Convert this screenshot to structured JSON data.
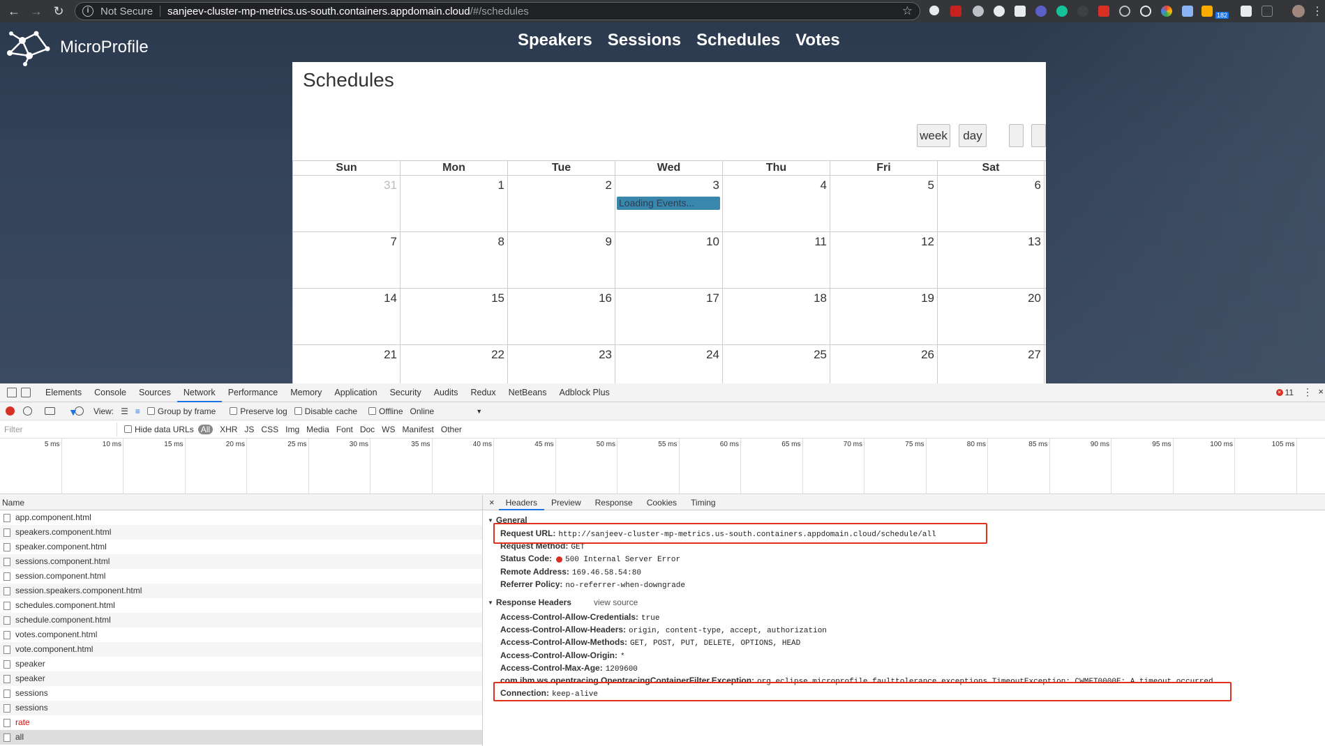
{
  "browser": {
    "security_label": "Not Secure",
    "url_host": "sanjeev-cluster-mp-metrics.us-south.containers.appdomain.cloud",
    "url_path": "/#/schedules",
    "ext_badge": "182"
  },
  "site": {
    "logo_text": "MicroProfile",
    "nav": [
      "Speakers",
      "Sessions",
      "Schedules",
      "Votes"
    ]
  },
  "calendar": {
    "title": "Schedules",
    "buttons": [
      "week",
      "day"
    ],
    "weekdays": [
      "Sun",
      "Mon",
      "Tue",
      "Wed",
      "Thu",
      "Fri",
      "Sat"
    ],
    "weeks": [
      [
        "31",
        "1",
        "2",
        "3",
        "4",
        "5",
        "6"
      ],
      [
        "7",
        "8",
        "9",
        "10",
        "11",
        "12",
        "13"
      ],
      [
        "14",
        "15",
        "16",
        "17",
        "18",
        "19",
        "20"
      ],
      [
        "21",
        "22",
        "23",
        "24",
        "25",
        "26",
        "27"
      ]
    ],
    "event_label": "Loading Events..."
  },
  "devtools": {
    "tabs": [
      "Elements",
      "Console",
      "Sources",
      "Network",
      "Performance",
      "Memory",
      "Application",
      "Security",
      "Audits",
      "Redux",
      "NetBeans",
      "Adblock Plus"
    ],
    "active_tab": "Network",
    "error_count": "11",
    "toolbar": {
      "view_label": "View:",
      "group_by_frame": "Group by frame",
      "preserve_log": "Preserve log",
      "disable_cache": "Disable cache",
      "offline": "Offline",
      "throttle": "Online"
    },
    "filter": {
      "placeholder": "Filter",
      "hide_data_urls": "Hide data URLs",
      "types": [
        "All",
        "XHR",
        "JS",
        "CSS",
        "Img",
        "Media",
        "Font",
        "Doc",
        "WS",
        "Manifest",
        "Other"
      ]
    },
    "timeline_ticks": [
      "5 ms",
      "10 ms",
      "15 ms",
      "20 ms",
      "25 ms",
      "30 ms",
      "35 ms",
      "40 ms",
      "45 ms",
      "50 ms",
      "55 ms",
      "60 ms",
      "65 ms",
      "70 ms",
      "75 ms",
      "80 ms",
      "85 ms",
      "90 ms",
      "95 ms",
      "100 ms",
      "105 ms"
    ],
    "name_header": "Name",
    "requests": [
      {
        "name": "app.component.html",
        "status": "ok"
      },
      {
        "name": "speakers.component.html",
        "status": "ok"
      },
      {
        "name": "speaker.component.html",
        "status": "ok"
      },
      {
        "name": "sessions.component.html",
        "status": "ok"
      },
      {
        "name": "session.component.html",
        "status": "ok"
      },
      {
        "name": "session.speakers.component.html",
        "status": "ok"
      },
      {
        "name": "schedules.component.html",
        "status": "ok"
      },
      {
        "name": "schedule.component.html",
        "status": "ok"
      },
      {
        "name": "votes.component.html",
        "status": "ok"
      },
      {
        "name": "vote.component.html",
        "status": "ok"
      },
      {
        "name": "speaker",
        "status": "ok"
      },
      {
        "name": "speaker",
        "status": "ok"
      },
      {
        "name": "sessions",
        "status": "ok"
      },
      {
        "name": "sessions",
        "status": "ok"
      },
      {
        "name": "rate",
        "status": "error"
      },
      {
        "name": "all",
        "status": "selected"
      }
    ],
    "detail_tabs": [
      "Headers",
      "Preview",
      "Response",
      "Cookies",
      "Timing"
    ],
    "general_title": "General",
    "general": [
      {
        "key": "Request URL:",
        "value": "http://sanjeev-cluster-mp-metrics.us-south.containers.appdomain.cloud/schedule/all"
      },
      {
        "key": "Request Method:",
        "value": "GET"
      },
      {
        "key": "Status Code:",
        "value": "500 Internal Server Error"
      },
      {
        "key": "Remote Address:",
        "value": "169.46.58.54:80"
      },
      {
        "key": "Referrer Policy:",
        "value": "no-referrer-when-downgrade"
      }
    ],
    "response_title": "Response Headers",
    "view_source": "view source",
    "response_headers": [
      {
        "key": "Access-Control-Allow-Credentials:",
        "value": "true"
      },
      {
        "key": "Access-Control-Allow-Headers:",
        "value": "origin, content-type, accept, authorization"
      },
      {
        "key": "Access-Control-Allow-Methods:",
        "value": "GET, POST, PUT, DELETE, OPTIONS, HEAD"
      },
      {
        "key": "Access-Control-Allow-Origin:",
        "value": "*"
      },
      {
        "key": "Access-Control-Max-Age:",
        "value": "1209600"
      },
      {
        "key": "com.ibm.ws.opentracing.OpentracingContainerFilter.Exception:",
        "value": "org.eclipse.microprofile.faulttolerance.exceptions.TimeoutException: CWMFT0000E: A timeout occurred."
      },
      {
        "key": "Connection:",
        "value": "keep-alive"
      }
    ],
    "colors": {
      "accent": "#1a73e8",
      "error": "#e0301e",
      "event": "#3a87ad"
    }
  }
}
